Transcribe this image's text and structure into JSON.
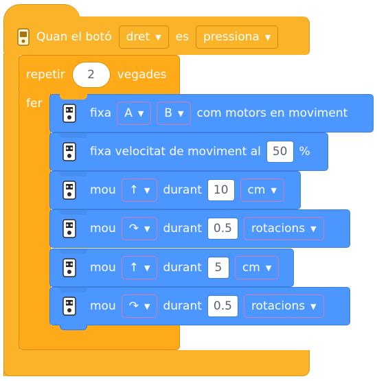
{
  "hat": {
    "label_prefix": "Quan el botó",
    "button_value": "dret",
    "label_mid": "es",
    "state_value": "pressiona"
  },
  "repeat": {
    "label_prefix": "repetir",
    "count": "2",
    "label_suffix": "vegades",
    "do_label": "fer"
  },
  "blocks": [
    {
      "label": "fixa",
      "motor_a": "A",
      "motor_b": "B",
      "label_suffix": "com motors en moviment"
    },
    {
      "label": "fixa velocitat de moviment al",
      "value": "50",
      "unit": "%"
    },
    {
      "label": "mou",
      "direction_icon": "up-arrow-icon",
      "direction": "↑",
      "label_mid": "durant",
      "value": "10",
      "unit": "cm"
    },
    {
      "label": "mou",
      "direction_icon": "rotate-right-icon",
      "direction": "↷",
      "label_mid": "durant",
      "value": "0.5",
      "unit": "rotacions"
    },
    {
      "label": "mou",
      "direction_icon": "up-arrow-icon",
      "direction": "↑",
      "label_mid": "durant",
      "value": "5",
      "unit": "cm"
    },
    {
      "label": "mou",
      "direction_icon": "rotate-right-icon",
      "direction": "↷",
      "label_mid": "durant",
      "value": "0.5",
      "unit": "rotacions"
    }
  ],
  "icons": {
    "dropdown": "▼",
    "hub": "hub-icon"
  },
  "colors": {
    "event_block": "#fbb42a",
    "control_block": "#ffab19",
    "motion_block": "#4c97ff"
  }
}
